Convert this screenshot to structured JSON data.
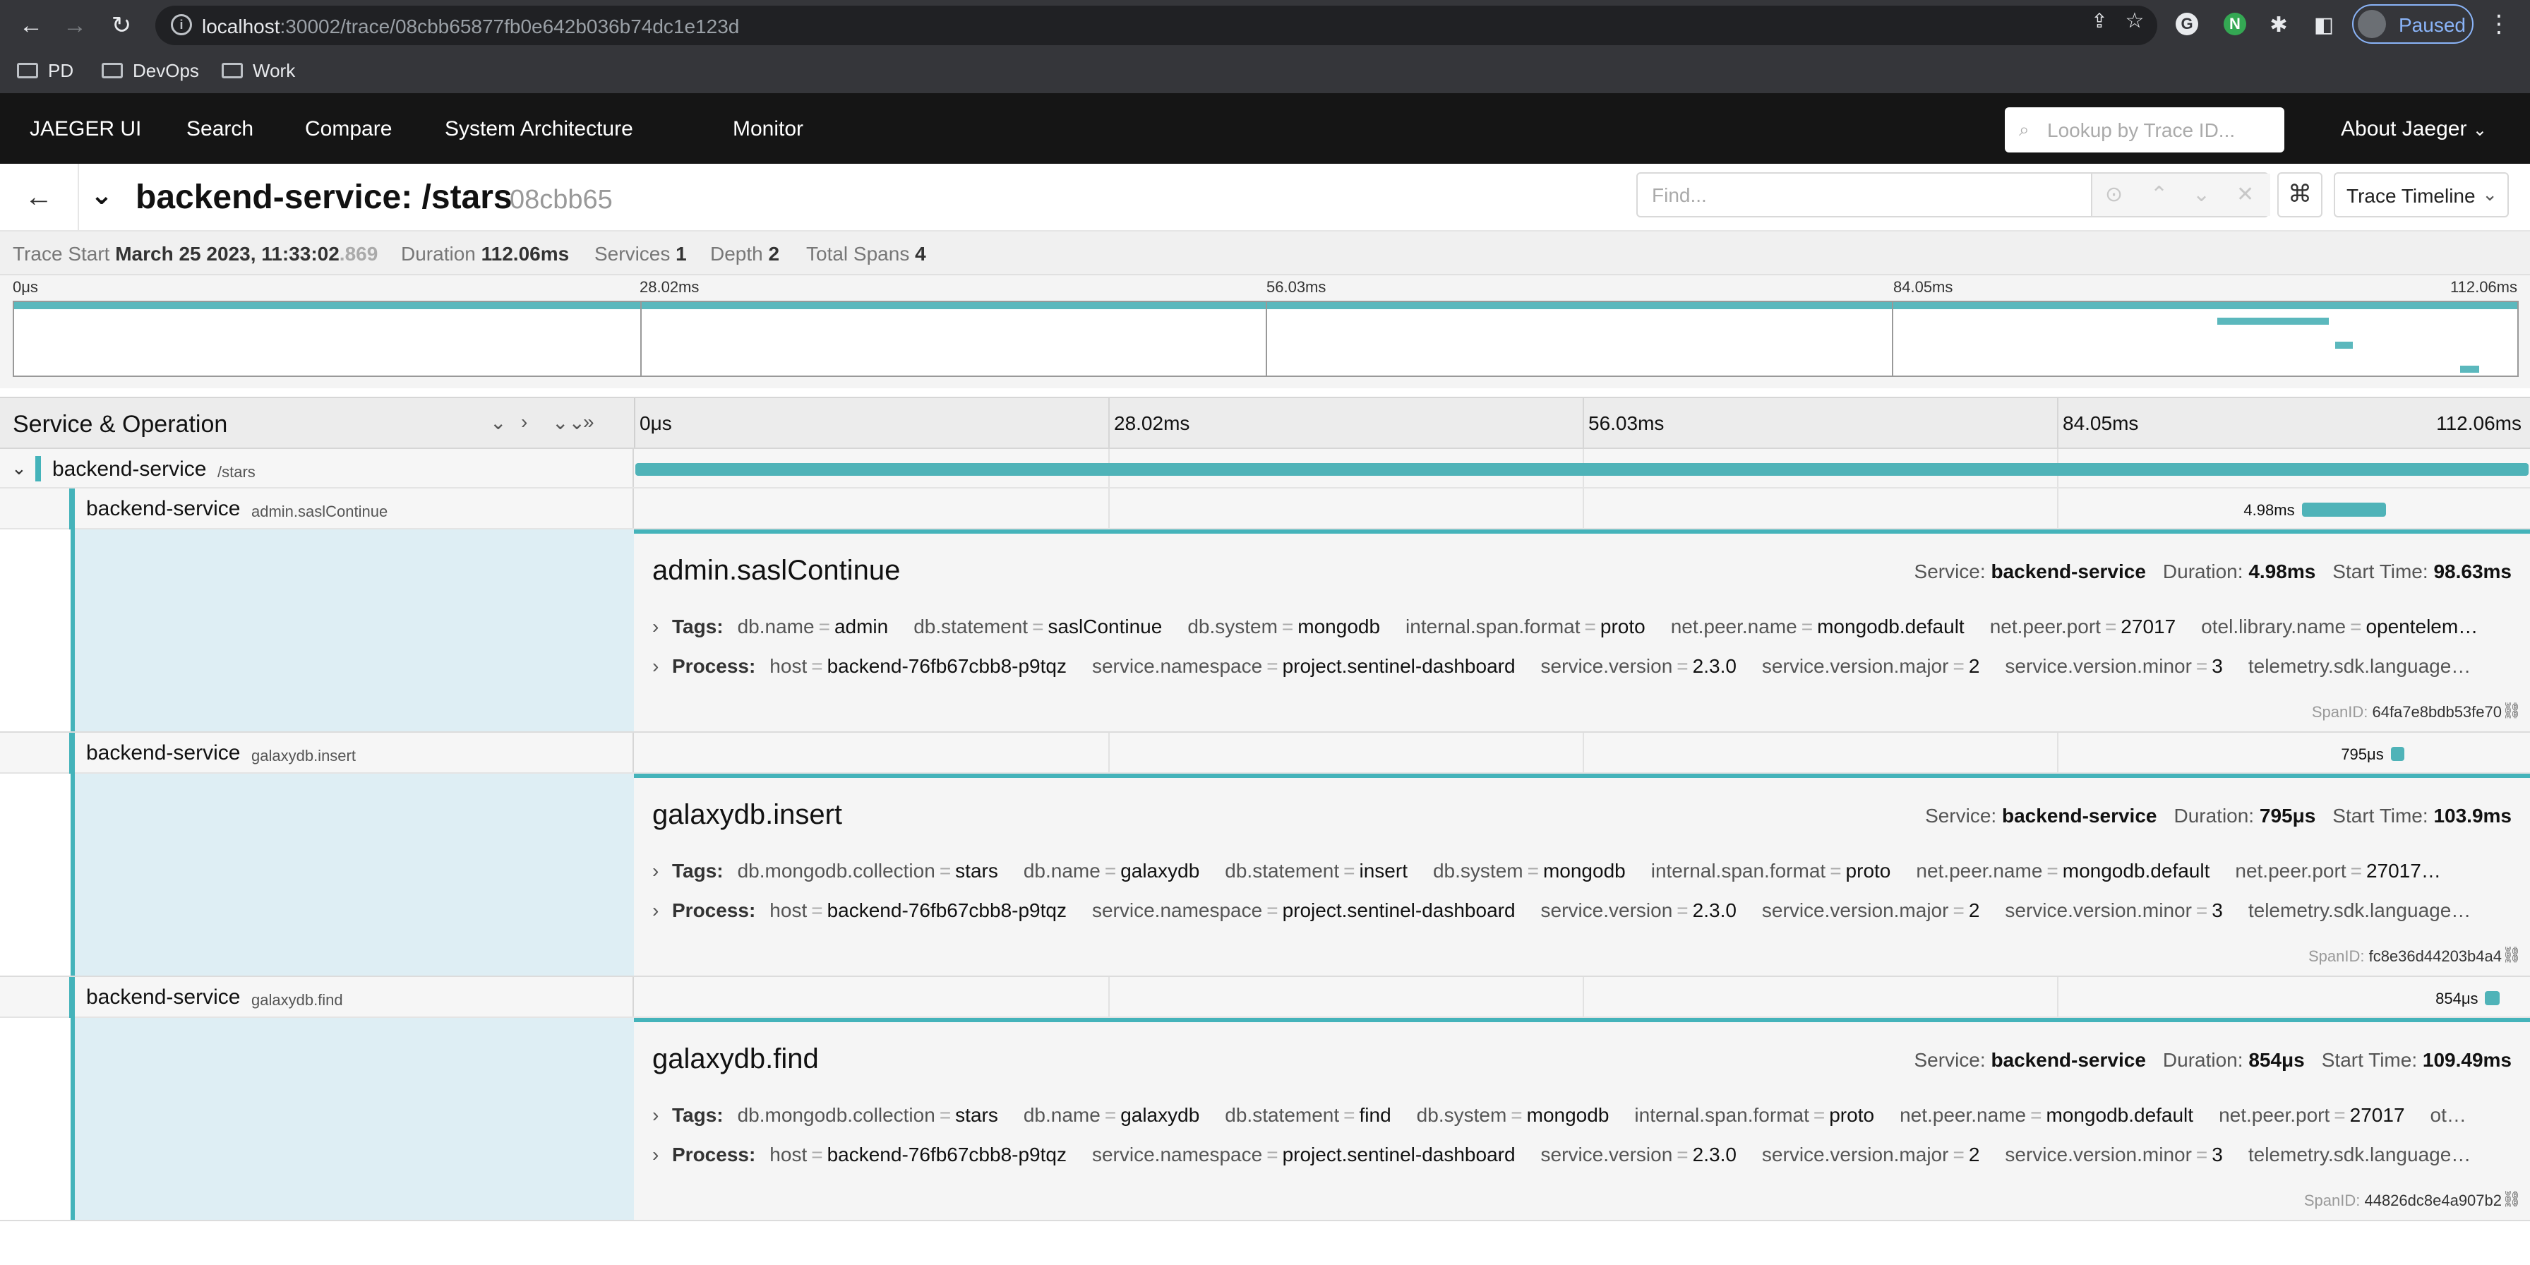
{
  "browser": {
    "url_host": "localhost",
    "url_path": ":30002/trace/08cbb65877fb0e642b036b74dc1e123d",
    "profile_label": "Paused",
    "bookmarks": [
      "PD",
      "DevOps",
      "Work"
    ]
  },
  "nav": {
    "brand": "JAEGER UI",
    "links": [
      "Search",
      "Compare",
      "System Architecture",
      "Monitor"
    ],
    "lookup_placeholder": "Lookup by Trace ID...",
    "about": "About Jaeger"
  },
  "trace": {
    "title": "backend-service: /stars",
    "id_short": "08cbb65",
    "find_placeholder": "Find...",
    "view_mode": "Trace Timeline",
    "summary": {
      "start_label": "Trace Start",
      "start_value": "March 25 2023, 11:33:02",
      "start_ms": ".869",
      "duration_label": "Duration",
      "duration_value": "112.06ms",
      "services_label": "Services",
      "services_value": "1",
      "depth_label": "Depth",
      "depth_value": "2",
      "spans_label": "Total Spans",
      "spans_value": "4"
    }
  },
  "timeline": {
    "ticks": [
      "0μs",
      "28.02ms",
      "56.03ms",
      "84.05ms",
      "112.06ms"
    ],
    "header_title": "Service & Operation",
    "total_ms": 112.06
  },
  "spans": [
    {
      "service": "backend-service",
      "operation": "/stars",
      "start_ms": 0,
      "duration_ms": 112.06,
      "duration_label": "",
      "depth": 0
    },
    {
      "service": "backend-service",
      "operation": "admin.saslContinue",
      "start_ms": 98.63,
      "duration_ms": 4.98,
      "duration_label": "4.98ms",
      "depth": 1,
      "detail": {
        "title": "admin.saslContinue",
        "service_label": "Service:",
        "service": "backend-service",
        "duration_label": "Duration:",
        "duration": "4.98ms",
        "start_label": "Start Time:",
        "start": "98.63ms",
        "tags_label": "Tags:",
        "tags": [
          {
            "k": "db.name",
            "v": "admin"
          },
          {
            "k": "db.statement",
            "v": "saslContinue"
          },
          {
            "k": "db.system",
            "v": "mongodb"
          },
          {
            "k": "internal.span.format",
            "v": "proto"
          },
          {
            "k": "net.peer.name",
            "v": "mongodb.default"
          },
          {
            "k": "net.peer.port",
            "v": "27017"
          },
          {
            "k": "otel.library.name",
            "v": "opentelem…"
          }
        ],
        "process_label": "Process:",
        "process": [
          {
            "k": "host",
            "v": "backend-76fb67cbb8-p9tqz"
          },
          {
            "k": "service.namespace",
            "v": "project.sentinel-dashboard"
          },
          {
            "k": "service.version",
            "v": "2.3.0"
          },
          {
            "k": "service.version.major",
            "v": "2"
          },
          {
            "k": "service.version.minor",
            "v": "3"
          },
          {
            "k": "telemetry.sdk.language…",
            "v": ""
          }
        ],
        "spanid_label": "SpanID:",
        "spanid": "64fa7e8bdb53fe70"
      }
    },
    {
      "service": "backend-service",
      "operation": "galaxydb.insert",
      "start_ms": 103.9,
      "duration_ms": 0.795,
      "duration_label": "795μs",
      "depth": 1,
      "detail": {
        "title": "galaxydb.insert",
        "service_label": "Service:",
        "service": "backend-service",
        "duration_label": "Duration:",
        "duration": "795μs",
        "start_label": "Start Time:",
        "start": "103.9ms",
        "tags_label": "Tags:",
        "tags": [
          {
            "k": "db.mongodb.collection",
            "v": "stars"
          },
          {
            "k": "db.name",
            "v": "galaxydb"
          },
          {
            "k": "db.statement",
            "v": "insert"
          },
          {
            "k": "db.system",
            "v": "mongodb"
          },
          {
            "k": "internal.span.format",
            "v": "proto"
          },
          {
            "k": "net.peer.name",
            "v": "mongodb.default"
          },
          {
            "k": "net.peer.port",
            "v": "27017…"
          }
        ],
        "process_label": "Process:",
        "process": [
          {
            "k": "host",
            "v": "backend-76fb67cbb8-p9tqz"
          },
          {
            "k": "service.namespace",
            "v": "project.sentinel-dashboard"
          },
          {
            "k": "service.version",
            "v": "2.3.0"
          },
          {
            "k": "service.version.major",
            "v": "2"
          },
          {
            "k": "service.version.minor",
            "v": "3"
          },
          {
            "k": "telemetry.sdk.language…",
            "v": ""
          }
        ],
        "spanid_label": "SpanID:",
        "spanid": "fc8e36d44203b4a4"
      }
    },
    {
      "service": "backend-service",
      "operation": "galaxydb.find",
      "start_ms": 109.49,
      "duration_ms": 0.854,
      "duration_label": "854μs",
      "depth": 1,
      "detail": {
        "title": "galaxydb.find",
        "service_label": "Service:",
        "service": "backend-service",
        "duration_label": "Duration:",
        "duration": "854μs",
        "start_label": "Start Time:",
        "start": "109.49ms",
        "tags_label": "Tags:",
        "tags": [
          {
            "k": "db.mongodb.collection",
            "v": "stars"
          },
          {
            "k": "db.name",
            "v": "galaxydb"
          },
          {
            "k": "db.statement",
            "v": "find"
          },
          {
            "k": "db.system",
            "v": "mongodb"
          },
          {
            "k": "internal.span.format",
            "v": "proto"
          },
          {
            "k": "net.peer.name",
            "v": "mongodb.default"
          },
          {
            "k": "net.peer.port",
            "v": "27017"
          },
          {
            "k": "ot…",
            "v": ""
          }
        ],
        "process_label": "Process:",
        "process": [
          {
            "k": "host",
            "v": "backend-76fb67cbb8-p9tqz"
          },
          {
            "k": "service.namespace",
            "v": "project.sentinel-dashboard"
          },
          {
            "k": "service.version",
            "v": "2.3.0"
          },
          {
            "k": "service.version.major",
            "v": "2"
          },
          {
            "k": "service.version.minor",
            "v": "3"
          },
          {
            "k": "telemetry.sdk.language…",
            "v": ""
          }
        ],
        "spanid_label": "SpanID:",
        "spanid": "44826dc8e4a907b2"
      }
    }
  ],
  "colors": {
    "accent": "#44b3ba",
    "span_bar": "#4fb3b8",
    "nav_bg": "#151515",
    "detail_fill": "#deeef4"
  }
}
